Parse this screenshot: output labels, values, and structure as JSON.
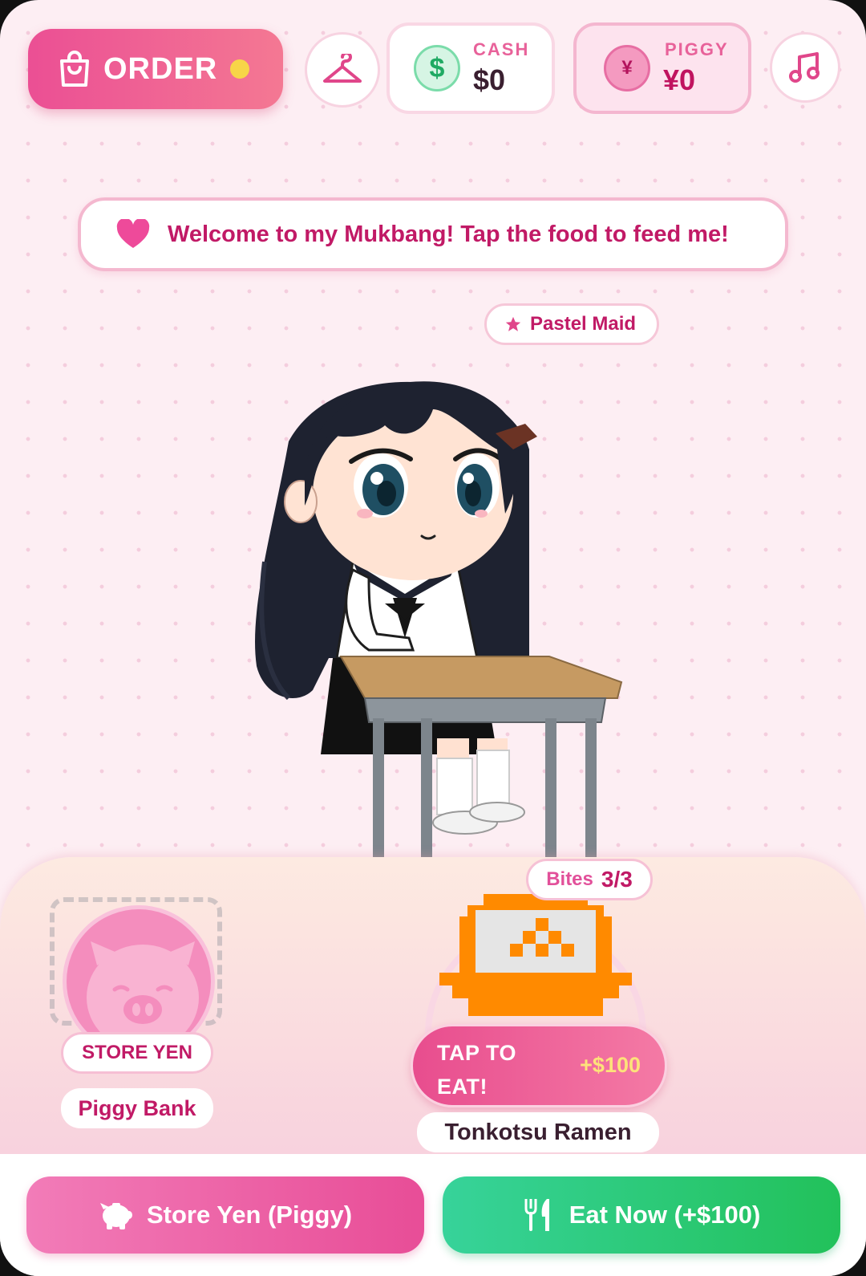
{
  "topbar": {
    "order_label": "ORDER",
    "cash": {
      "label": "CASH",
      "value": "$0",
      "icon": "$"
    },
    "piggy": {
      "label": "PIGGY",
      "value": "¥0",
      "icon": "¥"
    }
  },
  "banner": {
    "text": "Welcome to my Mukbang! Tap the food to feed me!"
  },
  "character": {
    "outfit": "Pastel Maid"
  },
  "piggy_bank": {
    "tag": "STORE YEN",
    "name": "Piggy Bank"
  },
  "food": {
    "bites_label": "Bites",
    "bites_value": "3/3",
    "tap_label": "TAP TO EAT!",
    "reward": "+$100",
    "name": "Tonkotsu Ramen"
  },
  "actions": {
    "store_label": "Store Yen (Piggy)",
    "eat_label": "Eat Now (+$100)"
  },
  "colors": {
    "accent_pink": "#e84d8e",
    "accent_green": "#22c15a",
    "background": "#fdeef3",
    "text_magenta": "#c11a66"
  }
}
